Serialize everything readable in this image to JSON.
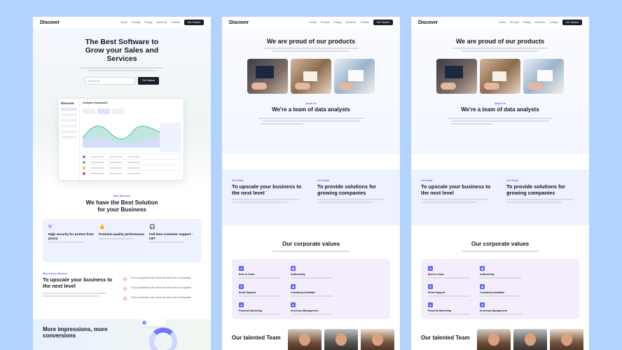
{
  "brand": {
    "logo": "Discover"
  },
  "nav": {
    "links": [
      "Home",
      "Product",
      "Pricing",
      "About Us",
      "Contact"
    ],
    "cta": "Get Started"
  },
  "hero": {
    "title": "The Best Software to Grow your Sales and Services",
    "email_placeholder": "Enter email",
    "submit": "Get Started"
  },
  "dashboard": {
    "logo": "Discover",
    "title": "Analytics Dashboard"
  },
  "solution": {
    "kicker": "Why Discover",
    "title": "We have the Best Solution for your Business",
    "features": [
      {
        "icon": "shield-icon",
        "title": "High security for protect from piracy"
      },
      {
        "icon": "thumbs-up-icon",
        "title": "Premium quality performance"
      },
      {
        "icon": "headset-icon",
        "title": "Full-time customer support - 24/7"
      }
    ]
  },
  "upscale": {
    "kicker": "Why choose Discover",
    "title": "To upscale your business to the next level",
    "items": [
      "Sed ut perspiciatis unde omnis iste natus error sit voluptatem.",
      "Sed ut perspiciatis unde omnis iste natus error sit voluptatem.",
      "Sed ut perspiciatis unde omnis iste natus error sit voluptatem."
    ]
  },
  "impress": {
    "title": "More impressions, more conversions"
  },
  "proud": {
    "title": "We are proud of our products"
  },
  "about": {
    "kicker": "About Us",
    "title": "We're a team of data analysts"
  },
  "goals": {
    "left_kicker": "Our Goals",
    "left_title": "To upscale your business to the next level",
    "right_kicker": "Our Vision",
    "right_title": "To provide solutions for growing companies"
  },
  "values": {
    "title": "Our corporate values",
    "items": [
      {
        "icon": "star-icon",
        "title": "Best in Class"
      },
      {
        "icon": "grid-icon",
        "title": "Authenticity"
      },
      {
        "icon": "mail-icon",
        "title": "Email Support"
      },
      {
        "icon": "globe-icon",
        "title": "Constantly Available"
      },
      {
        "icon": "chart-icon",
        "title": "Powerful Marketing"
      },
      {
        "icon": "box-icon",
        "title": "Inventory Management"
      }
    ]
  },
  "team": {
    "title": "Our talented Team"
  }
}
